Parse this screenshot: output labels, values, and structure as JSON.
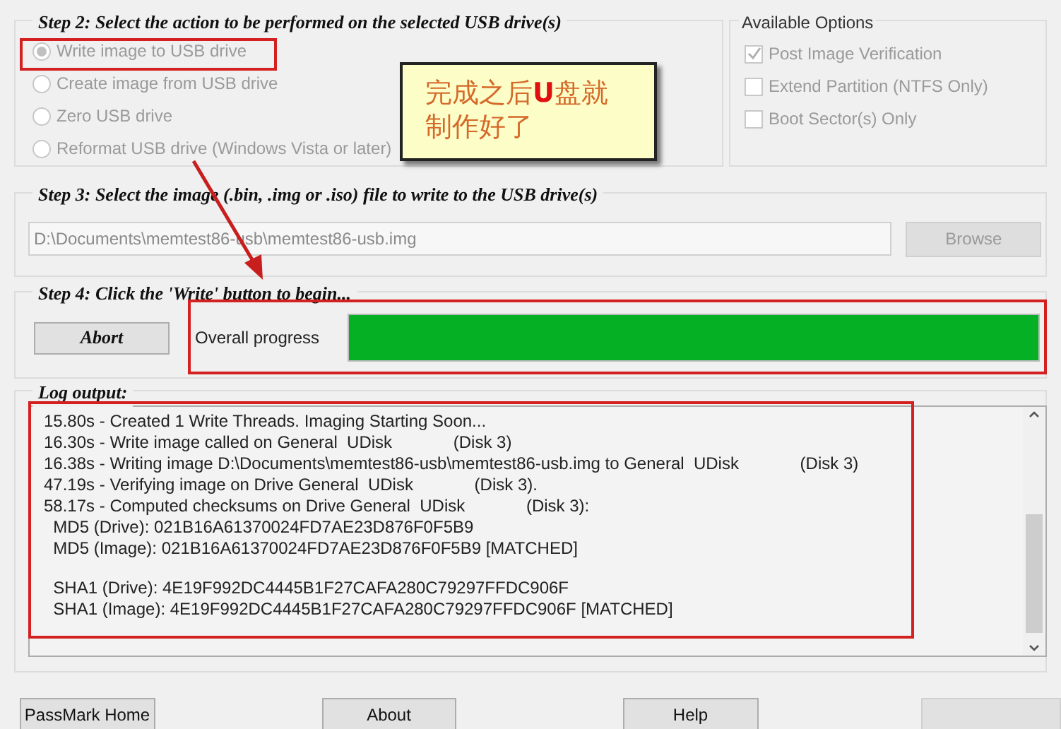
{
  "step2": {
    "title": "Step 2: Select the action to be performed on the selected USB drive(s)",
    "actions": [
      {
        "label": "Write image to USB drive",
        "selected": true
      },
      {
        "label": "Create image from USB drive",
        "selected": false
      },
      {
        "label": "Zero USB drive",
        "selected": false
      },
      {
        "label": "Reformat USB drive (Windows Vista or later)",
        "selected": false
      }
    ]
  },
  "options": {
    "title": "Available Options",
    "items": [
      {
        "label": "Post Image Verification",
        "checked": true
      },
      {
        "label": "Extend Partition (NTFS Only)",
        "checked": false
      },
      {
        "label": "Boot Sector(s) Only",
        "checked": false
      }
    ]
  },
  "step3": {
    "title": "Step 3: Select the image (.bin, .img or .iso) file to write to the USB drive(s)",
    "path": "D:\\Documents\\memtest86-usb\\memtest86-usb.img",
    "browse": "Browse"
  },
  "step4": {
    "title": "Step 4: Click the 'Write' button to begin...",
    "abort": "Abort",
    "progress_label": "Overall progress",
    "level": 1
  },
  "log": {
    "title": "Log output:",
    "blocks": [
      [
        "15.80s - Created 1 Write Threads. Imaging Starting Soon...",
        "16.30s - Write image called on General  UDisk             (Disk 3)",
        "16.38s - Writing image D:\\Documents\\memtest86-usb\\memtest86-usb.img to General  UDisk             (Disk 3)",
        "47.19s - Verifying image on Drive General  UDisk             (Disk 3).",
        "58.17s - Computed checksums on Drive General  UDisk             (Disk 3):",
        "  MD5 (Drive): 021B16A61370024FD7AE23D876F0F5B9",
        "  MD5 (Image): 021B16A61370024FD7AE23D876F0F5B9 [MATCHED]"
      ],
      [
        "  SHA1 (Drive): 4E19F992DC4445B1F27CAFA280C79297FFDC906F",
        "  SHA1 (Image): 4E19F992DC4445B1F27CAFA280C79297FFDC906F [MATCHED]"
      ]
    ]
  },
  "buttons": [
    "PassMark Home",
    "About",
    "Help"
  ],
  "callout": {
    "parts": [
      {
        "text": "完成之后",
        "emphasis": false
      },
      {
        "text": "U",
        "emphasis": true
      },
      {
        "text": "盘就制作好了",
        "emphasis": false
      }
    ]
  }
}
